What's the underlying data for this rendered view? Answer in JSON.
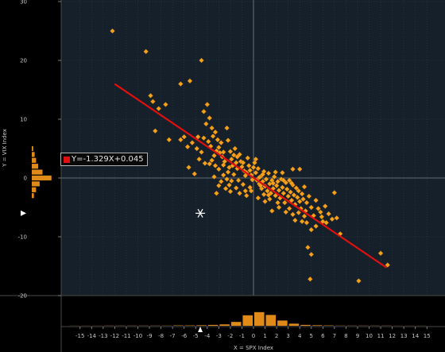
{
  "chart_data": {
    "type": "scatter",
    "xlabel": "X = SPX Index",
    "ylabel": "Y = VIX Index",
    "xlim": [
      -16,
      16
    ],
    "ylim": [
      -20,
      30
    ],
    "xticks": [
      -15,
      -14,
      -13,
      -12,
      -11,
      -10,
      -9,
      -8,
      -7,
      -6,
      -5,
      -4,
      -3,
      -2,
      -1,
      0,
      1,
      2,
      3,
      4,
      5,
      6,
      7,
      8,
      9,
      10,
      11,
      12,
      13,
      14,
      15
    ],
    "yticks": [
      -20,
      -10,
      0,
      10,
      20,
      30
    ],
    "regression": {
      "label": "Y=-1.329X+0.045",
      "slope": -1.329,
      "intercept": 0.045,
      "x_range": [
        -12,
        11.5
      ],
      "color": "#e01010"
    },
    "current_point": {
      "x": -4.6,
      "y": -6
    },
    "point_color": "#f5a01a",
    "points": [
      [
        -12.2,
        25
      ],
      [
        -9.3,
        21.5
      ],
      [
        -4.5,
        20
      ],
      [
        -5.5,
        16.5
      ],
      [
        -6.3,
        16
      ],
      [
        -8.9,
        14
      ],
      [
        -8.7,
        13
      ],
      [
        -8.2,
        11.8
      ],
      [
        -7.6,
        12.5
      ],
      [
        -8.5,
        8
      ],
      [
        -7.3,
        6.5
      ],
      [
        -6,
        7
      ],
      [
        -6.3,
        6.5
      ],
      [
        -5.7,
        5.3
      ],
      [
        -5.3,
        6
      ],
      [
        -4.8,
        7
      ],
      [
        -5.6,
        1.8
      ],
      [
        -5.1,
        0.7
      ],
      [
        -4.9,
        5
      ],
      [
        -4.7,
        3.2
      ],
      [
        -4.5,
        4.4
      ],
      [
        -4.3,
        6.8
      ],
      [
        -4.2,
        2.5
      ],
      [
        -4,
        12.5
      ],
      [
        -4.3,
        11.3
      ],
      [
        -3.8,
        10.2
      ],
      [
        -4.1,
        9.2
      ],
      [
        -3.6,
        8.5
      ],
      [
        -3.3,
        7.8
      ],
      [
        -3.5,
        7.1
      ],
      [
        -3.9,
        6.2
      ],
      [
        -3.7,
        5.4
      ],
      [
        -3.2,
        4.6
      ],
      [
        -3.4,
        3.8
      ],
      [
        -3.6,
        3
      ],
      [
        -3.8,
        2.4
      ],
      [
        -3.1,
        6.5
      ],
      [
        -2.8,
        6
      ],
      [
        -3,
        5.2
      ],
      [
        -2.9,
        4.3
      ],
      [
        -3.3,
        2.1
      ],
      [
        -3,
        1.5
      ],
      [
        -2.7,
        3.6
      ],
      [
        -2.5,
        2.8
      ],
      [
        -2.6,
        2.2
      ],
      [
        -2.3,
        8.5
      ],
      [
        -2.1,
        1.8
      ],
      [
        -2.2,
        1
      ],
      [
        -2.6,
        0.5
      ],
      [
        -2,
        4.5
      ],
      [
        -1.9,
        3.2
      ],
      [
        -1.8,
        2.1
      ],
      [
        -1.6,
        5
      ],
      [
        -1.5,
        2.6
      ],
      [
        -1.4,
        1.6
      ],
      [
        -1.7,
        0.6
      ],
      [
        -1.9,
        -0.5
      ],
      [
        -2.1,
        -1.2
      ],
      [
        -2.4,
        -1.8
      ],
      [
        -1.2,
        4
      ],
      [
        -1.1,
        2.8
      ],
      [
        -1,
        1.9
      ],
      [
        -0.8,
        1.2
      ],
      [
        -0.7,
        0.4
      ],
      [
        -1.3,
        -0.4
      ],
      [
        -0.9,
        -1.1
      ],
      [
        -0.5,
        3.4
      ],
      [
        -0.4,
        2.1
      ],
      [
        -0.3,
        1.3
      ],
      [
        -0.2,
        0.5
      ],
      [
        -0.1,
        -0.3
      ],
      [
        0,
        1.8
      ],
      [
        0.2,
        0.9
      ],
      [
        0.3,
        -0.4
      ],
      [
        0.4,
        1.6
      ],
      [
        0.5,
        -1
      ],
      [
        0.6,
        0.2
      ],
      [
        0.7,
        -1.8
      ],
      [
        0.8,
        -0.6
      ],
      [
        0.9,
        1.1
      ],
      [
        1,
        -1.4
      ],
      [
        1.1,
        -0.2
      ],
      [
        1.2,
        -2.2
      ],
      [
        1.3,
        0.8
      ],
      [
        1.4,
        -1
      ],
      [
        1.5,
        -2.6
      ],
      [
        1.6,
        -0.4
      ],
      [
        1.7,
        -1.8
      ],
      [
        1.8,
        0.2
      ],
      [
        1.9,
        -3
      ],
      [
        2,
        -1.3
      ],
      [
        2.1,
        -0.6
      ],
      [
        2.2,
        -2.1
      ],
      [
        2.3,
        -3.4
      ],
      [
        2.4,
        -0.2
      ],
      [
        2.5,
        -1.6
      ],
      [
        2.6,
        -2.6
      ],
      [
        2.7,
        -4.2
      ],
      [
        2.8,
        -0.8
      ],
      [
        2.9,
        -1.9
      ],
      [
        3,
        -3.1
      ],
      [
        3.1,
        -0.4
      ],
      [
        3.2,
        -2.4
      ],
      [
        3.3,
        -3.8
      ],
      [
        3.4,
        -1.2
      ],
      [
        3.5,
        -2.9
      ],
      [
        3.6,
        -4.5
      ],
      [
        3.7,
        -1.7
      ],
      [
        3.8,
        -3.3
      ],
      [
        3.9,
        -2.2
      ],
      [
        4,
        -4
      ],
      [
        4.1,
        -5.2
      ],
      [
        4.2,
        -2.7
      ],
      [
        4.3,
        -3.6
      ],
      [
        4.4,
        -1.5
      ],
      [
        4.5,
        -5.6
      ],
      [
        4.6,
        -4.2
      ],
      [
        4.8,
        -3.1
      ],
      [
        5,
        -5
      ],
      [
        5.2,
        -6.4
      ],
      [
        5.4,
        -3.8
      ],
      [
        5.6,
        -5.2
      ],
      [
        5.9,
        -6.6
      ],
      [
        6.2,
        -4.8
      ],
      [
        6.5,
        -6.1
      ],
      [
        6.8,
        -7
      ],
      [
        7,
        -2.5
      ],
      [
        7.2,
        -6.8
      ],
      [
        3.4,
        1.5
      ],
      [
        4,
        1.5
      ],
      [
        -1.5,
        -1.7
      ],
      [
        -0.6,
        -3
      ],
      [
        -0.2,
        -2.2
      ],
      [
        0.4,
        -3.4
      ],
      [
        1,
        -4
      ],
      [
        1.6,
        -5.6
      ],
      [
        2.2,
        -5
      ],
      [
        3.6,
        -7.2
      ],
      [
        4.6,
        -7.6
      ],
      [
        5,
        -8.8
      ],
      [
        4.7,
        -11.8
      ],
      [
        5,
        -13
      ],
      [
        7.5,
        -9.5
      ],
      [
        4.9,
        -17.2
      ],
      [
        9.1,
        -17.5
      ],
      [
        11,
        -12.8
      ],
      [
        11.6,
        -14.8
      ],
      [
        -3.2,
        -2.6
      ],
      [
        -2.8,
        -0.6
      ],
      [
        -2.3,
        -0.2
      ],
      [
        -1.2,
        -2.6
      ],
      [
        -0.3,
        -1.6
      ],
      [
        0.9,
        -2.8
      ],
      [
        1.4,
        -3.6
      ],
      [
        2.8,
        -5.8
      ],
      [
        3.4,
        -6.2
      ],
      [
        4.2,
        -7.4
      ],
      [
        5.4,
        -8.2
      ],
      [
        6,
        -7.4
      ],
      [
        -0.9,
        2.6
      ],
      [
        0.1,
        2.6
      ],
      [
        0.8,
        0.6
      ],
      [
        1.9,
        1
      ],
      [
        2.5,
        0.9
      ],
      [
        -3.4,
        0.2
      ],
      [
        -2.2,
        6.4
      ],
      [
        -1.4,
        3.6
      ],
      [
        -0.7,
        -2.2
      ],
      [
        0.6,
        -1.3
      ],
      [
        1.3,
        -2.9
      ],
      [
        2.1,
        -4.2
      ],
      [
        3.1,
        -5.2
      ],
      [
        3.9,
        -5.9
      ],
      [
        4.4,
        -6.5
      ],
      [
        5.8,
        -5.8
      ],
      [
        6.3,
        -7.6
      ],
      [
        -2.6,
        4.4
      ],
      [
        -1.7,
        3.9
      ],
      [
        -0.6,
        0.9
      ],
      [
        0.5,
        0.1
      ],
      [
        1.7,
        -0.9
      ],
      [
        2.6,
        -0.4
      ],
      [
        3.3,
        -0.9
      ],
      [
        0.2,
        3.2
      ],
      [
        -3,
        -1.3
      ],
      [
        -2,
        -2.3
      ]
    ],
    "histogram_x": {
      "bin_x": [
        -15.5,
        -14.5,
        -13.5,
        -12.5,
        -11.5,
        -10.5,
        -9.5,
        -8.5,
        -7.5,
        -6.5,
        -5.5,
        -4.5,
        -3.5,
        -2.5,
        -1.5,
        -0.5,
        0.5,
        1.5,
        2.5,
        3.5,
        4.5,
        5.5,
        6.5,
        7.5,
        8.5,
        9.5,
        10.5,
        11.5,
        12.5,
        13.5,
        14.5
      ],
      "counts": [
        0.5,
        0.5,
        0.5,
        1,
        1,
        1,
        1,
        1,
        1,
        2,
        2,
        3,
        5,
        8,
        22,
        60,
        78,
        62,
        30,
        12,
        5,
        3,
        2,
        1,
        1,
        1,
        1,
        1,
        0.5,
        0.5,
        0.5
      ]
    },
    "histogram_y": {
      "bin_y": [
        5,
        4,
        3,
        2,
        1,
        0,
        -1,
        -2,
        -3
      ],
      "counts": [
        4,
        8,
        12,
        18,
        30,
        55,
        22,
        12,
        6
      ]
    },
    "x_marker": -4.6,
    "y_marker": -6
  }
}
